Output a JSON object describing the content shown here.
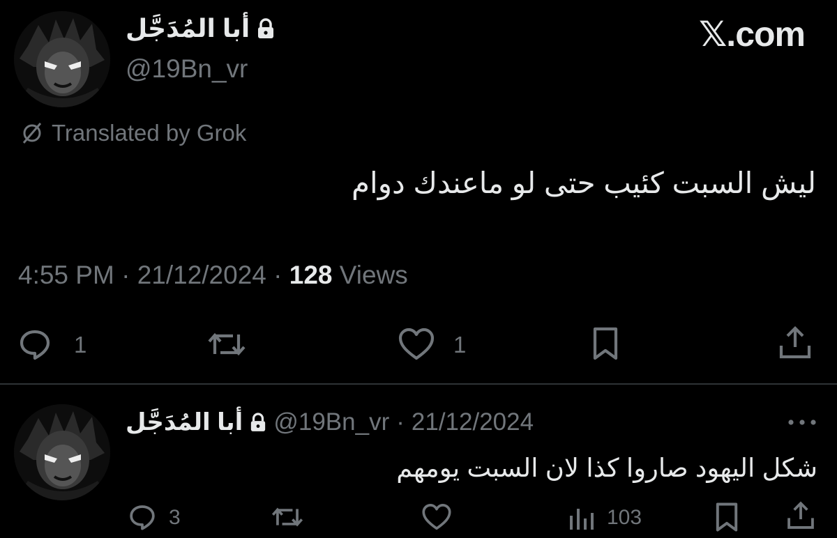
{
  "brand": {
    "label": "𝕏.com"
  },
  "main_tweet": {
    "author_name": "أبا المُدَجَّل",
    "handle": "@19Bn_vr",
    "translated_label": "Translated by Grok",
    "text": "ليش السبت كئيب حتى لو ماعندك دوام",
    "time": "4:55 PM",
    "dot": "·",
    "date": "21/12/2024",
    "views_count": "128",
    "views_label": "Views",
    "actions": {
      "reply_count": "1",
      "like_count": "1"
    }
  },
  "reply_tweet": {
    "author_name": "أبا المُدَجَّل",
    "handle": "@19Bn_vr",
    "date": "21/12/2024",
    "dot": "·",
    "text": "شكل اليهود صاروا كذا لان السبت يومهم",
    "actions": {
      "reply_count": "3",
      "views_count": "103"
    }
  },
  "colors": {
    "background": "#000000",
    "text": "#e7e9ea",
    "muted": "#71767b",
    "divider": "#2f3336"
  }
}
